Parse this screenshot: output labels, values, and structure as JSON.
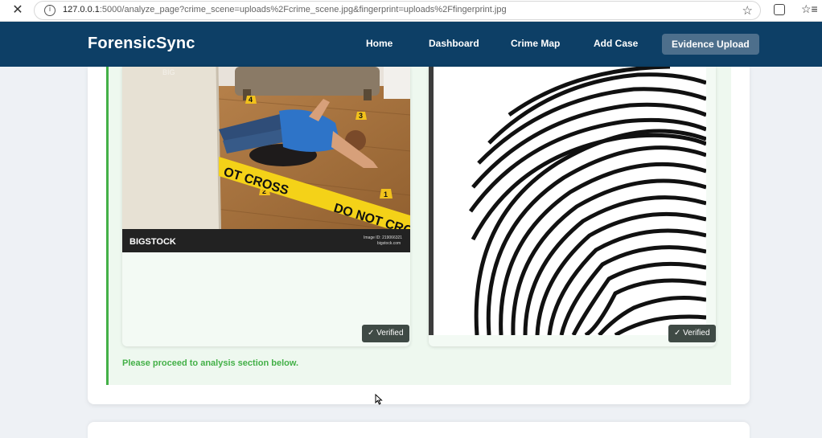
{
  "browser": {
    "url_host": "127.0.0.1",
    "url_rest": ":5000/analyze_page?crime_scene=uploads%2Fcrime_scene.jpg&fingerprint=uploads%2Ffingerprint.jpg"
  },
  "nav": {
    "brand": "ForensicSync",
    "links": [
      "Home",
      "Dashboard",
      "Crime Map",
      "Add Case",
      "Evidence Upload"
    ],
    "active": "Evidence Upload"
  },
  "evidence": {
    "crime_scene": {
      "stock_logo": "BIGSTOCK",
      "tape_text_1": "OT CROSS",
      "tape_text_2": "DO NOT CROS",
      "markers": [
        "4",
        "3",
        "2",
        "1"
      ],
      "image_id": "Image ID: 219066321",
      "source": "bigstock.com",
      "watermark": "BIG",
      "badge": "✓ Verified"
    },
    "fingerprint": {
      "badge": "✓ Verified"
    },
    "message": "Please proceed to analysis section below."
  },
  "colors": {
    "navbar": "#0d3f66",
    "active_link": "#4d6f8c",
    "success": "#43b047",
    "alert_bg": "#eef8ef"
  }
}
